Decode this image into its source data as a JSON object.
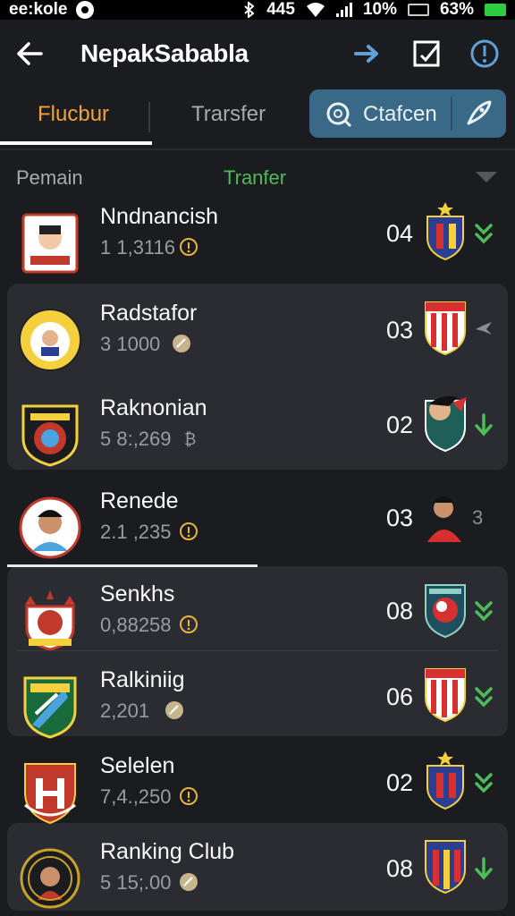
{
  "status_bar": {
    "carrier": "ee:kole",
    "signal_text": "445",
    "wifi_percent": "10%",
    "battery_percent": "63%"
  },
  "header": {
    "title": "NepakSababla",
    "icons": [
      "back-arrow-icon",
      "forward-arrow-icon",
      "edit-square-icon",
      "info-icon"
    ]
  },
  "tabs": {
    "items": [
      {
        "label": "Flucbur",
        "active": true
      },
      {
        "label": "Trarsfer",
        "active": false
      }
    ],
    "action_label": "Ctafcen"
  },
  "columns": {
    "player": "Pemain",
    "transfer": "Tranfer"
  },
  "colors": {
    "accent_orange": "#f0a33a",
    "accent_green": "#4cbb5a",
    "action_blue": "#3a6987",
    "card_bg": "#2b2c31",
    "page_bg": "#1b1c1f"
  },
  "players": [
    {
      "name": "Nndnancish",
      "value": "1 1,3116",
      "rank": "04",
      "trend": "double-down"
    },
    {
      "name": "Radstafor",
      "value": "3 1000",
      "rank": "03",
      "trend": "bird"
    },
    {
      "name": "Raknonian",
      "value": "5 8:,269",
      "rank": "02",
      "trend": "down"
    },
    {
      "name": "Renede",
      "value": "2.1 ,235",
      "rank": "03",
      "trend_text": "3",
      "trend": "text"
    },
    {
      "name": "Senkhs",
      "value": "0,88258",
      "rank": "08",
      "trend": "double-down"
    },
    {
      "name": "Ralkiniig",
      "value": "2,201",
      "rank": "06",
      "trend": "double-down"
    },
    {
      "name": "Selelen",
      "value": "7,4.,250",
      "rank": "02",
      "trend": "double-down"
    },
    {
      "name": "Ranking Club",
      "value": "5 15;.00",
      "rank": "08",
      "trend": "down"
    }
  ]
}
